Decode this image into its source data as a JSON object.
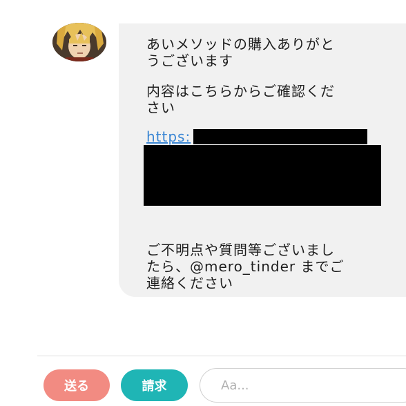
{
  "message": {
    "line1": "あいメソッドの購入ありがと",
    "line2": "うございます",
    "line3": "内容はこちらからご確認くだ",
    "line4": "さい",
    "link_text": "https:",
    "line5": "ご不明点や質問等ございまし",
    "line6": "たら、@mero_tinder までご",
    "line7": "連絡ください"
  },
  "composer": {
    "send_label": "送る",
    "request_label": "請求",
    "input_placeholder": "Aa..."
  },
  "colors": {
    "send_button": "#f28b82",
    "request_button": "#1fb5b5",
    "link": "#3a86d4",
    "bubble": "#f1f1f1"
  }
}
